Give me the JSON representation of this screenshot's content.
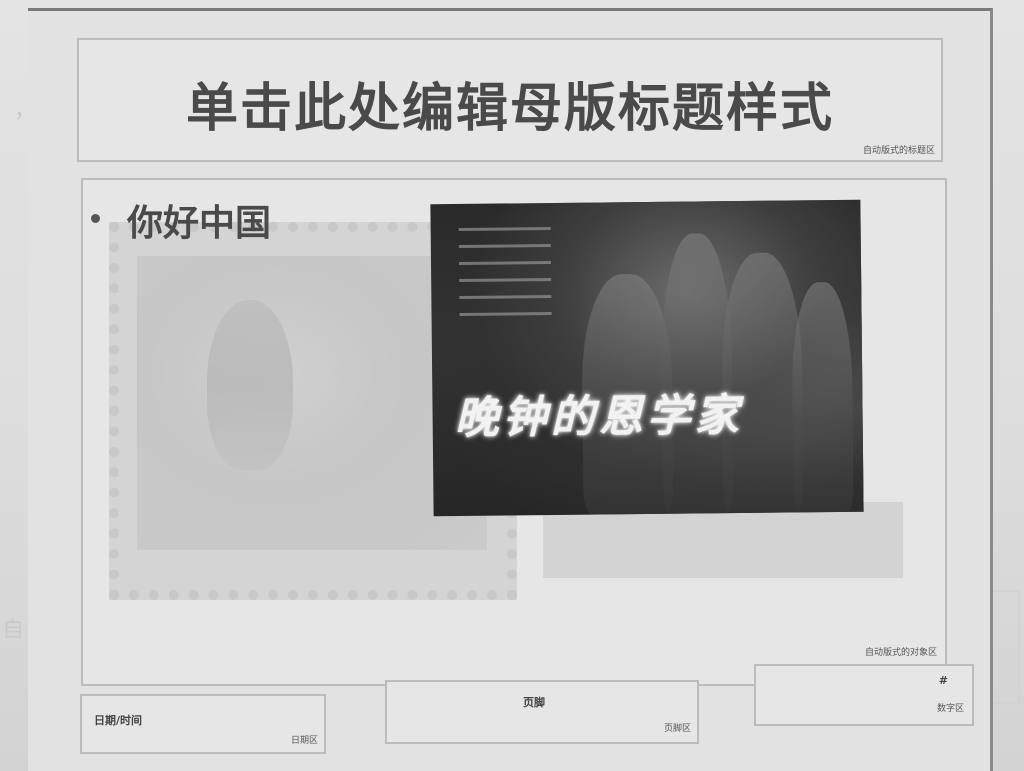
{
  "slide_master": {
    "title_placeholder": {
      "text": "单击此处编辑母版标题样式",
      "area_tag": "自动版式的标题区"
    },
    "body_placeholder": {
      "bullet_text": "你好中国",
      "area_tag": "自动版式的对象区",
      "film_image": {
        "title_text": "晚钟的恩学家"
      }
    },
    "footer": {
      "date": {
        "label": "日期/时间",
        "area_tag": "日期区"
      },
      "footer_text": {
        "label": "页脚",
        "area_tag": "页脚区"
      },
      "number": {
        "label": "#",
        "area_tag": "数字区"
      }
    }
  },
  "background_bleed": {
    "left_text": "自 文 样式",
    "top_text": "，商"
  },
  "colors": {
    "title_text": "#4a4a4a",
    "placeholder_border": "#bcbcbc",
    "paper": "#dcdcdc",
    "film_dark": "#2a2a2a"
  }
}
